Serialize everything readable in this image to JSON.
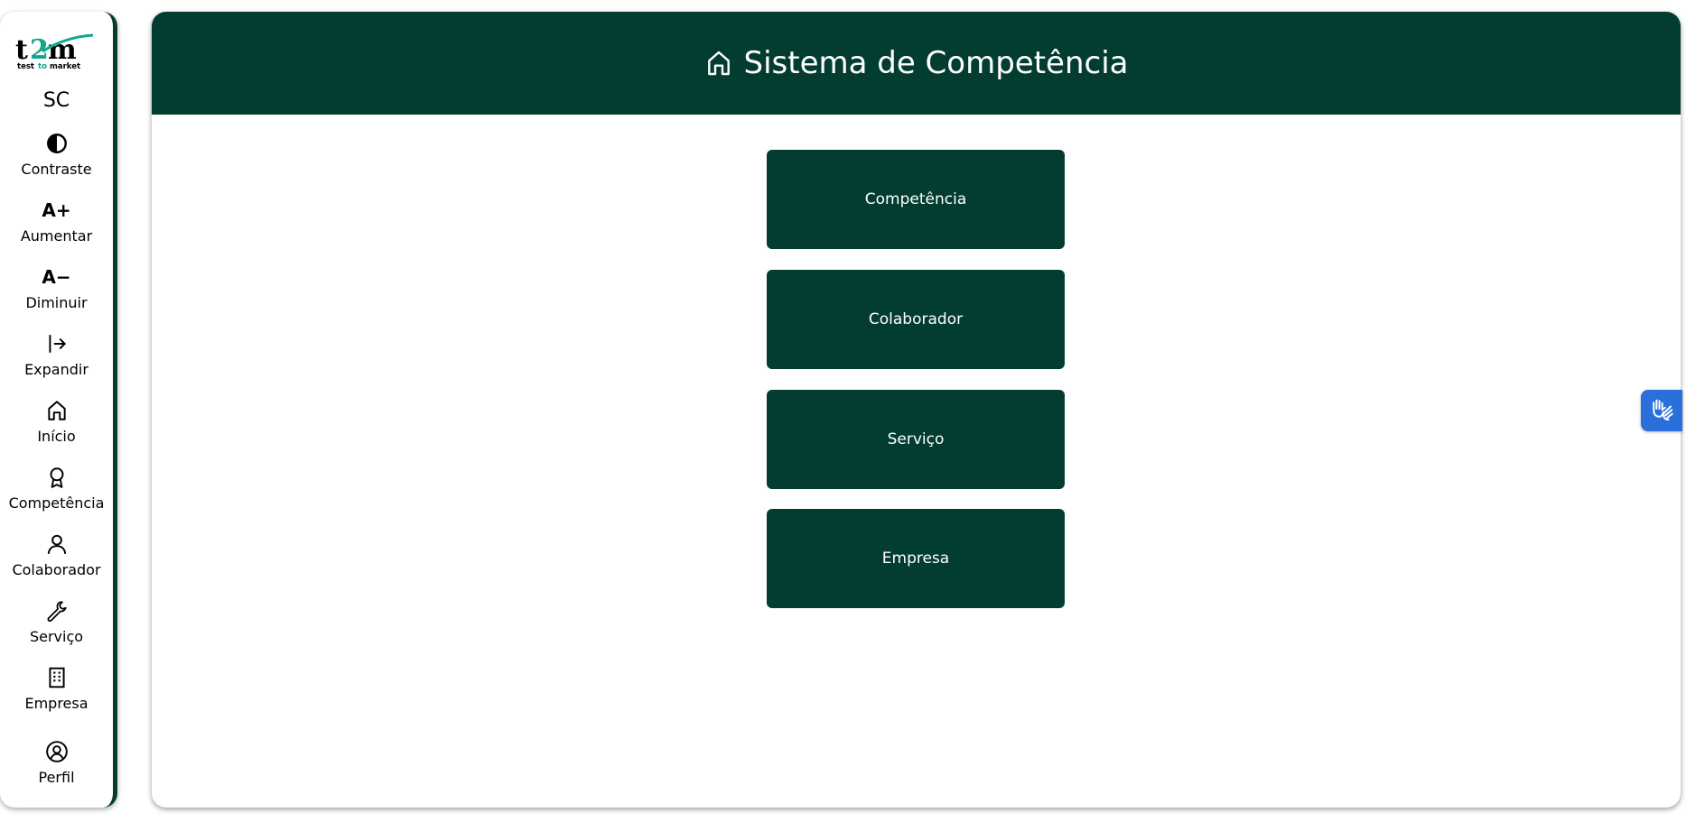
{
  "brand": {
    "logo_text": "t2m",
    "logo_tagline": "test to market",
    "app_abbr": "SC"
  },
  "sidebar": {
    "items": [
      {
        "label": "Contraste",
        "icon": "contrast-icon"
      },
      {
        "label": "Aumentar",
        "icon": "font-increase-icon",
        "icon_text": "A+"
      },
      {
        "label": "Diminuir",
        "icon": "font-decrease-icon",
        "icon_text": "A−"
      },
      {
        "label": "Expandir",
        "icon": "expand-icon"
      },
      {
        "label": "Início",
        "icon": "home-icon"
      },
      {
        "label": "Competência",
        "icon": "award-icon"
      },
      {
        "label": "Colaborador",
        "icon": "user-icon"
      },
      {
        "label": "Serviço",
        "icon": "wrench-icon"
      },
      {
        "label": "Empresa",
        "icon": "building-icon"
      },
      {
        "label": "Perfil",
        "icon": "profile-icon"
      }
    ]
  },
  "header": {
    "title": "Sistema de Competência",
    "icon": "home-icon"
  },
  "main": {
    "buttons": [
      {
        "label": "Competência"
      },
      {
        "label": "Colaborador"
      },
      {
        "label": "Serviço"
      },
      {
        "label": "Empresa"
      }
    ]
  },
  "accessibility_widget": {
    "icon": "sign-language-icon"
  },
  "colors": {
    "primary": "#033d31",
    "widget": "#2a6fdb",
    "logo_accent": "#0fa88a"
  }
}
